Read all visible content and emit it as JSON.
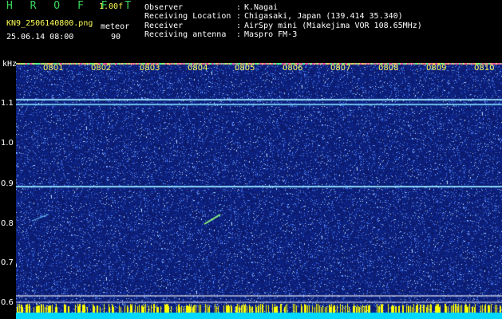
{
  "header": {
    "app_title": "H R O F F T",
    "version": "1.00f",
    "filename": "KN9_2506140800.png",
    "mode_label": "meteor",
    "datetime": "25.06.14 08:00",
    "mode_value": "90"
  },
  "metadata": [
    {
      "label": "Observer",
      "value": "K.Nagai"
    },
    {
      "label": "Receiving Location",
      "value": "Chigasaki, Japan (139.414 35.340)"
    },
    {
      "label": "Receiver",
      "value": "AirSpy mini (Miakejima VOR 108.65MHz)"
    },
    {
      "label": "Receiving antenna",
      "value": "Maspro FM-3"
    }
  ],
  "axis": {
    "unit": "kHz",
    "y_ticks": [
      "1.1",
      "1.0",
      "0.9",
      "0.8",
      "0.7",
      "0.6"
    ],
    "x_ticks": [
      "0801",
      "0802",
      "0803",
      "0804",
      "0805",
      "0806",
      "0807",
      "0808",
      "0809",
      "0810"
    ]
  },
  "colors": {
    "background": "#000000",
    "noise_dark": "#101a78",
    "carrier": "#7fd7ff",
    "title_green": "#39d65b",
    "tick_yellow": "#ffff55",
    "level_bar": "#00d8ff"
  }
}
